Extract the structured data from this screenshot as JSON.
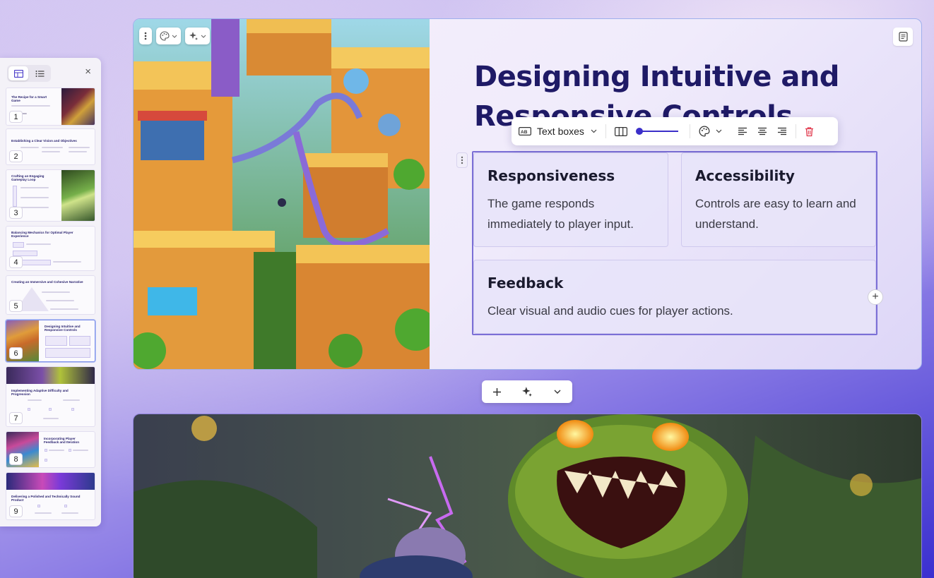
{
  "panel": {
    "close_label": "×",
    "thumbnails": [
      {
        "num": "1",
        "title": "The Recipe for a Smart Game"
      },
      {
        "num": "2",
        "title": "Establishing a Clear Vision and Objectives"
      },
      {
        "num": "3",
        "title": "Crafting an Engaging Gameplay Loop"
      },
      {
        "num": "4",
        "title": "Balancing Mechanics for Optimal Player Experience"
      },
      {
        "num": "5",
        "title": "Creating an Immersive and Cohesive Narrative"
      },
      {
        "num": "6",
        "title": "Designing Intuitive and Responsive Controls"
      },
      {
        "num": "7",
        "title": "Implementing Adaptive Difficulty and Progression"
      },
      {
        "num": "8",
        "title": "Incorporating Player Feedback and Iteration"
      },
      {
        "num": "9",
        "title": "Delivering a Polished and Technically Sound Product"
      }
    ]
  },
  "slide": {
    "heading": "Designing Intuitive and Responsive Controls",
    "cards": [
      {
        "title": "Responsiveness",
        "body": "The game responds immediately to player input."
      },
      {
        "title": "Accessibility",
        "body": "Controls are easy to learn and understand."
      },
      {
        "title": "Feedback",
        "body": "Clear visual and audio cues for player actions."
      }
    ]
  },
  "toolbar": {
    "layout_label": "Text boxes"
  },
  "add_circle_label": "+",
  "colors": {
    "accent": "#3b2fc9",
    "heading": "#1f1a66",
    "delete": "#e0364a"
  }
}
